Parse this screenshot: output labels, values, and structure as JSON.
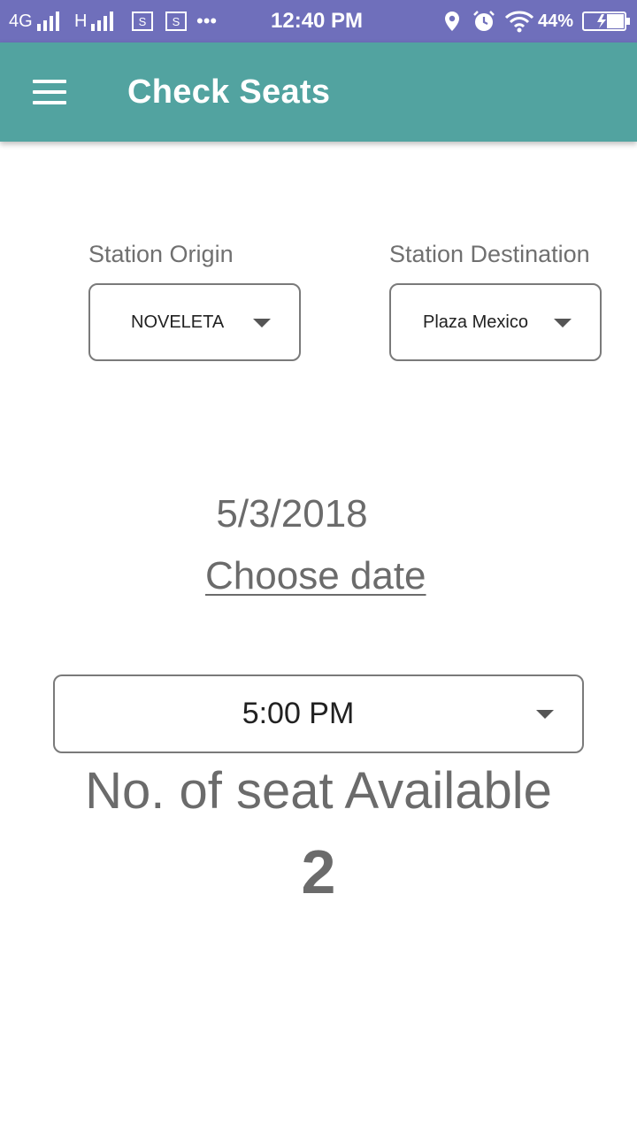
{
  "status_bar": {
    "network_1": "4G",
    "network_2": "H",
    "more": "•••",
    "time": "12:40 PM",
    "battery": "44%"
  },
  "app_bar": {
    "title": "Check Seats",
    "menu_icon": "hamburger-menu-icon"
  },
  "origin": {
    "label": "Station Origin",
    "selected": "NOVELETA"
  },
  "destination": {
    "label": "Station Destination",
    "selected": "Plaza Mexico"
  },
  "date": {
    "value": "5/3/2018",
    "choose_label": "Choose date"
  },
  "time_select": {
    "selected": "5:00 PM"
  },
  "seats": {
    "label": "No. of seat Available",
    "count": "2"
  },
  "colors": {
    "status_bar": "#6f6fbb",
    "app_bar": "#52a3a0",
    "text_grey": "#6b6b6b"
  }
}
